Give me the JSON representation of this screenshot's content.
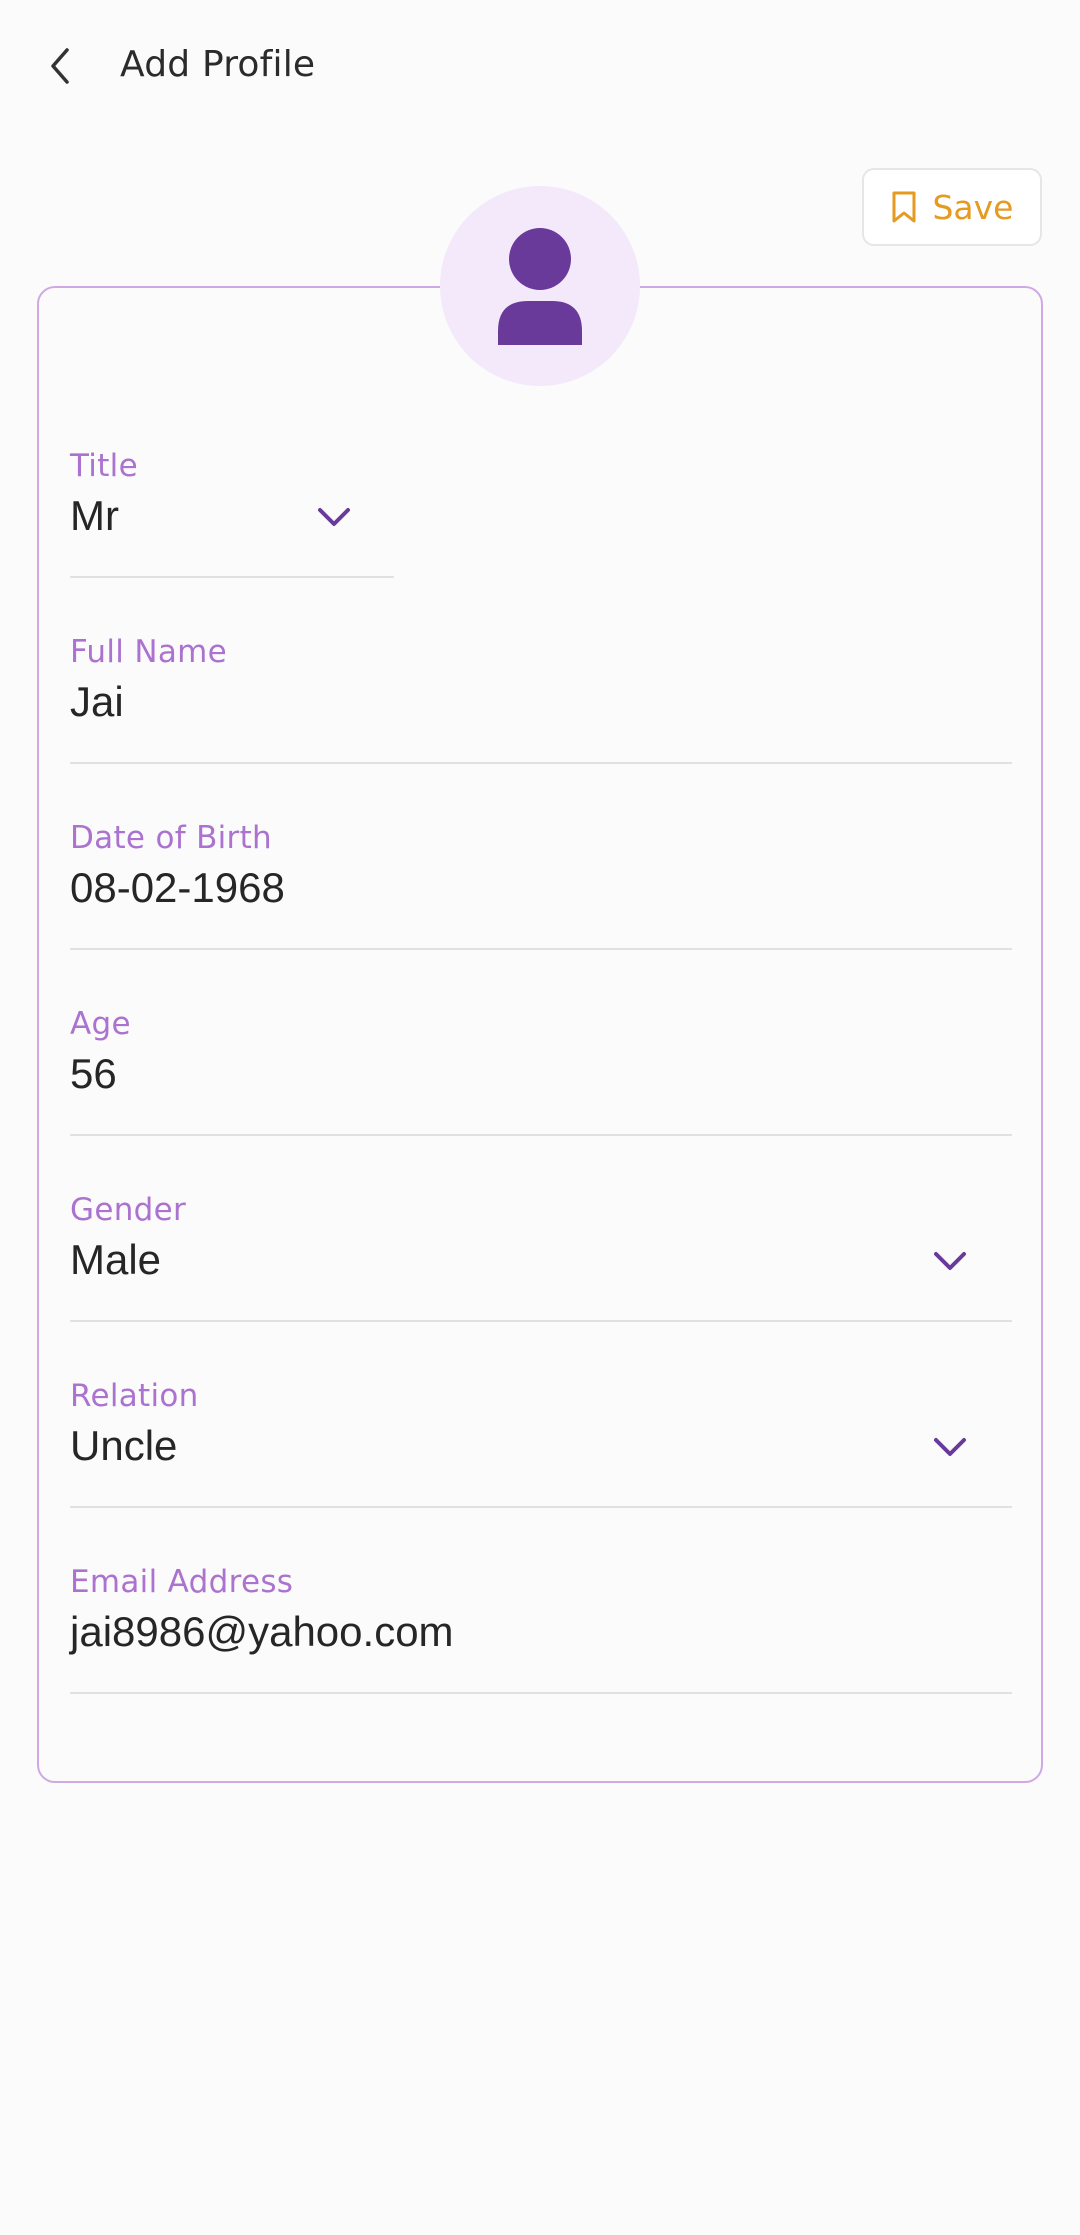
{
  "header": {
    "title": "Add Profile",
    "back_icon": "chevron-left-icon"
  },
  "toolbar": {
    "save_label": "Save",
    "save_icon": "bookmark-icon",
    "save_color": "#e69a1f"
  },
  "avatar": {
    "icon": "person-icon",
    "icon_color": "#6a3a9b",
    "background": "#f3e9fb"
  },
  "form": {
    "title": {
      "label": "Title",
      "value": "Mr"
    },
    "full_name": {
      "label": "Full Name",
      "value": "Jai"
    },
    "dob": {
      "label": "Date of Birth",
      "value": "08-02-1968"
    },
    "age": {
      "label": "Age",
      "value": "56"
    },
    "gender": {
      "label": "Gender",
      "value": "Male"
    },
    "relation": {
      "label": "Relation",
      "value": "Uncle"
    },
    "email": {
      "label": "Email Address",
      "value": "jai8986@yahoo.com"
    }
  },
  "colors": {
    "label": "#ab73cf",
    "card_border": "#cfa8e4",
    "chevron": "#6a3a9b"
  }
}
